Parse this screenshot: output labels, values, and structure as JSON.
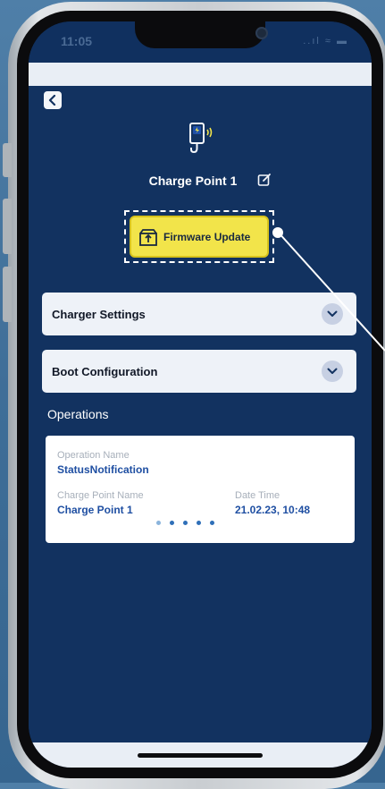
{
  "status_bar": {
    "time": "11:05",
    "icons": "..ıl ≈ ▬"
  },
  "header": {
    "title": "Charge Point 1"
  },
  "firmware_button": {
    "label": "Firmware Update"
  },
  "accordions": [
    {
      "label": "Charger Settings"
    },
    {
      "label": "Boot Configuration"
    }
  ],
  "operations": {
    "heading": "Operations",
    "card": {
      "operation_name_label": "Operation Name",
      "operation_name_value": "StatusNotification",
      "charge_point_name_label": "Charge Point Name",
      "charge_point_name_value": "Charge Point 1",
      "date_time_label": "Date Time",
      "date_time_value": "21.02.23, 10:48",
      "carousel_dots": 5,
      "active_dot": 1
    }
  },
  "colors": {
    "screen_background": "#123260",
    "accent_yellow": "#f2e44a",
    "link_blue": "#1f4fa2"
  },
  "icons": [
    "back-chevron-icon",
    "ev-charger-icon",
    "edit-icon",
    "firmware-box-icon",
    "chevron-down-icon"
  ]
}
